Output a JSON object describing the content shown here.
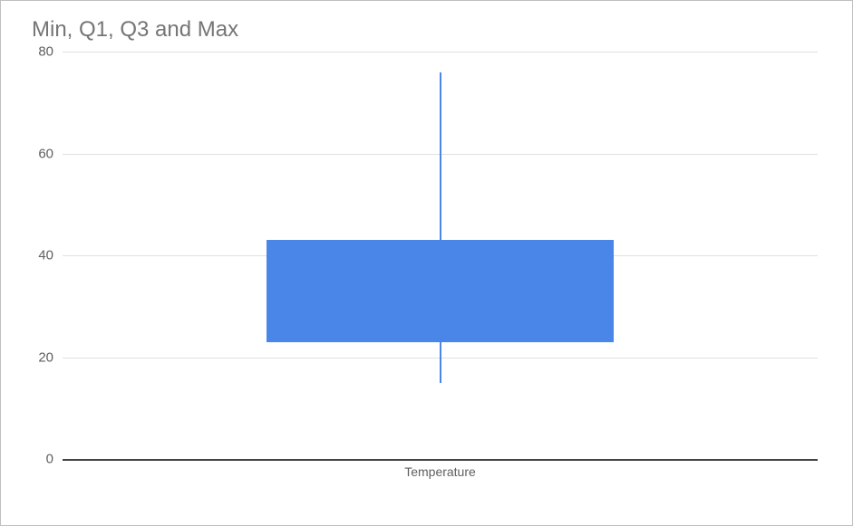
{
  "chart_data": {
    "type": "box",
    "title": "Min, Q1, Q3 and Max",
    "categories": [
      "Temperature"
    ],
    "series": [
      {
        "name": "Temperature",
        "min": 15,
        "q1": 23,
        "q3": 43,
        "max": 76
      }
    ],
    "ylim": [
      0,
      80
    ],
    "yticks": [
      0,
      20,
      40,
      60,
      80
    ],
    "box_color": "#4a86e8"
  }
}
